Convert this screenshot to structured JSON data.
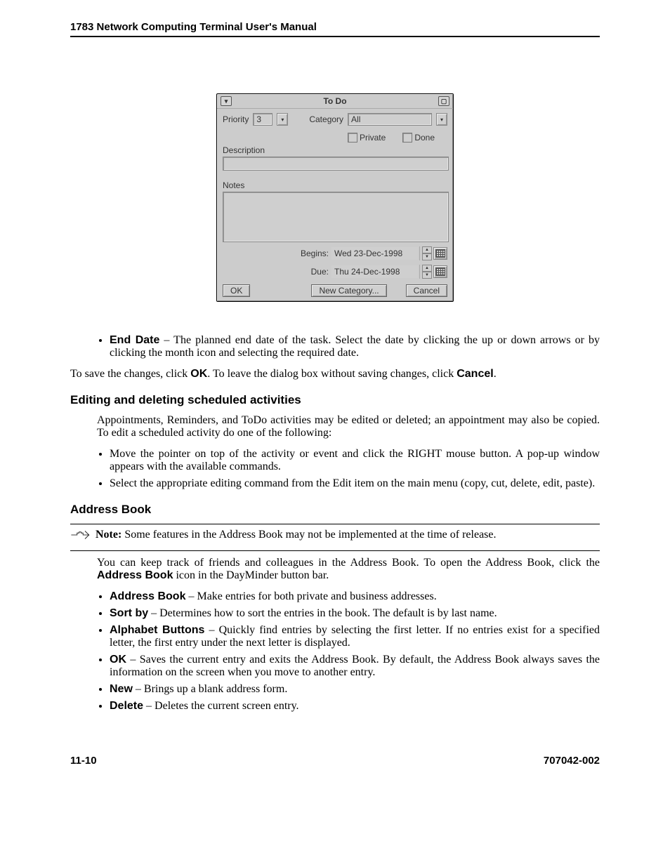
{
  "header": {
    "title": "1783 Network Computing Terminal User's Manual"
  },
  "dialog": {
    "title": "To Do",
    "priority_label": "Priority",
    "priority_value": "3",
    "category_label": "Category",
    "category_value": "All",
    "private_label": "Private",
    "done_label": "Done",
    "description_label": "Description",
    "notes_label": "Notes",
    "begins_label": "Begins:",
    "begins_value": "Wed 23-Dec-1998",
    "due_label": "Due:",
    "due_value": "Thu 24-Dec-1998",
    "ok": "OK",
    "new_category": "New Category...",
    "cancel": "Cancel"
  },
  "end_date": {
    "term": "End Date",
    "text": " – The planned end date of the task. Select the date by clicking the up or down arrows or by clicking the month icon and selecting the required date."
  },
  "save_para": {
    "pre": "To save the changes, click ",
    "ok": "OK",
    "mid": ". To leave the dialog box without saving changes, click ",
    "cancel": "Cancel",
    "post": "."
  },
  "sec1": {
    "heading": "Editing and deleting scheduled activities",
    "intro": "Appointments, Reminders, and ToDo activities may be edited or deleted; an appointment may also be copied. To edit a scheduled activity do one of the following:",
    "b1": "Move the pointer on top of the activity or event and click the RIGHT mouse button. A pop-up window appears with the available commands.",
    "b2": "Select the appropriate editing command from the Edit item on the main menu (copy, cut, delete, edit, paste)."
  },
  "sec2": {
    "heading": "Address Book",
    "note_label": "Note:",
    "note_text": " Some features in the Address Book may not be implemented at the time of release.",
    "intro_pre": "You can keep track of friends and colleagues in the Address Book. To open the Address Book, click the ",
    "intro_bold": "Address Book",
    "intro_post": " icon in the DayMinder button bar.",
    "items": [
      {
        "term": "Address Book",
        "text": " – Make entries for both private and business addresses."
      },
      {
        "term": "Sort by",
        "text": " – Determines how to sort the entries in the book. The default is by last name."
      },
      {
        "term": "Alphabet Buttons",
        "text": " – Quickly find entries by selecting the first letter. If no entries exist for a specified letter, the first entry under the next letter is displayed."
      },
      {
        "term": "OK",
        "text": " – Saves the current entry and exits the Address Book. By default, the Address Book always saves the information on the screen when you move to another entry."
      },
      {
        "term": "New",
        "text": " – Brings up a blank address form."
      },
      {
        "term": "Delete",
        "text": " – Deletes the current screen entry."
      }
    ]
  },
  "footer": {
    "page": "11-10",
    "doc": "707042-002"
  }
}
